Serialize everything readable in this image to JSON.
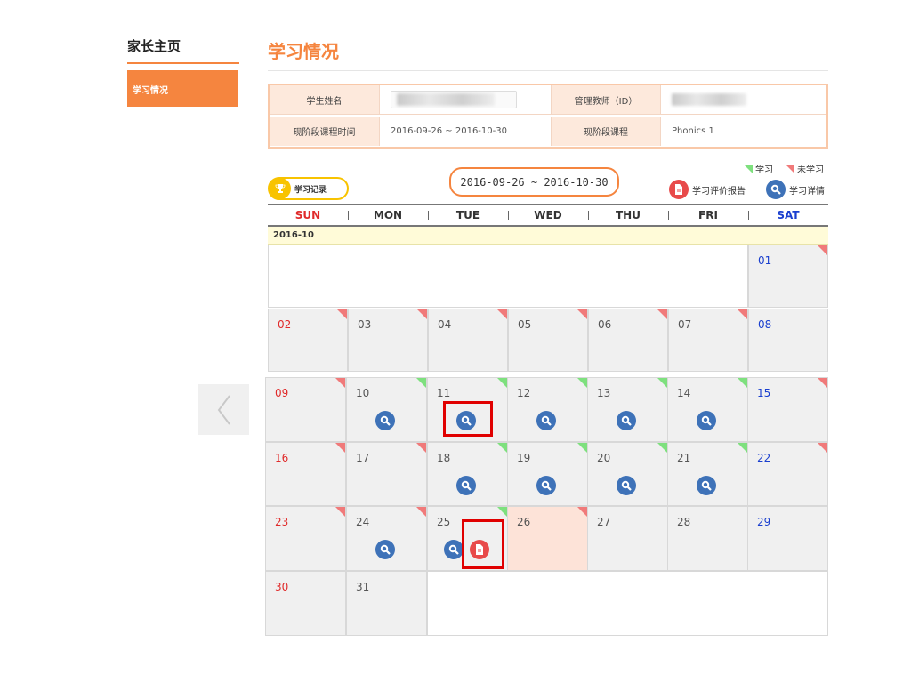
{
  "sidebar": {
    "title": "家长主页",
    "item": "学习情况"
  },
  "page": {
    "title": "学习情况"
  },
  "info": {
    "student_name_label": "学生姓名",
    "teacher_label": "管理教师（ID）",
    "period_label": "现阶段课程时间",
    "period_value": "2016-09-26 ~ 2016-10-30",
    "course_label": "现阶段课程",
    "course_value": "Phonics 1"
  },
  "calendar": {
    "record_button": "学习记录",
    "date_range": "2016-09-26 ~ 2016-10-30",
    "legend": {
      "studied": "学习",
      "not_studied": "未学习",
      "report": "学习评价报告",
      "detail": "学习详情"
    },
    "weekdays": [
      "SUN",
      "MON",
      "TUE",
      "WED",
      "THU",
      "FRI",
      "SAT"
    ],
    "month_label": "2016-10",
    "day_labels": [
      "01",
      "02",
      "03",
      "04",
      "05",
      "06",
      "07",
      "08",
      "09",
      "10",
      "11",
      "12",
      "13",
      "14",
      "15",
      "16",
      "17",
      "18",
      "19",
      "20",
      "21",
      "22",
      "23",
      "24",
      "25",
      "26",
      "27",
      "28",
      "29",
      "30",
      "31"
    ],
    "days": [
      {
        "day": 1,
        "flag": "not-studied"
      },
      {
        "day": 2,
        "flag": "not-studied"
      },
      {
        "day": 3,
        "flag": "not-studied"
      },
      {
        "day": 4,
        "flag": "not-studied"
      },
      {
        "day": 5,
        "flag": "not-studied"
      },
      {
        "day": 6,
        "flag": "not-studied"
      },
      {
        "day": 7,
        "flag": "not-studied"
      },
      {
        "day": 8,
        "flag": "none"
      },
      {
        "day": 9,
        "flag": "not-studied"
      },
      {
        "day": 10,
        "flag": "studied",
        "icons": [
          "detail"
        ]
      },
      {
        "day": 11,
        "flag": "studied",
        "icons": [
          "detail"
        ],
        "highlight": true
      },
      {
        "day": 12,
        "flag": "studied",
        "icons": [
          "detail"
        ]
      },
      {
        "day": 13,
        "flag": "studied",
        "icons": [
          "detail"
        ]
      },
      {
        "day": 14,
        "flag": "studied",
        "icons": [
          "detail"
        ]
      },
      {
        "day": 15,
        "flag": "not-studied"
      },
      {
        "day": 16,
        "flag": "not-studied"
      },
      {
        "day": 17,
        "flag": "not-studied"
      },
      {
        "day": 18,
        "flag": "studied",
        "icons": [
          "detail"
        ]
      },
      {
        "day": 19,
        "flag": "studied",
        "icons": [
          "detail"
        ]
      },
      {
        "day": 20,
        "flag": "studied",
        "icons": [
          "detail"
        ]
      },
      {
        "day": 21,
        "flag": "studied",
        "icons": [
          "detail"
        ]
      },
      {
        "day": 22,
        "flag": "not-studied"
      },
      {
        "day": 23,
        "flag": "not-studied"
      },
      {
        "day": 24,
        "flag": "not-studied",
        "icons": [
          "detail"
        ]
      },
      {
        "day": 25,
        "flag": "studied",
        "icons": [
          "detail",
          "report"
        ],
        "highlight_report": true
      },
      {
        "day": 26,
        "flag": "not-studied",
        "today": true
      },
      {
        "day": 27,
        "flag": "none"
      },
      {
        "day": 28,
        "flag": "none"
      },
      {
        "day": 29,
        "flag": "none"
      },
      {
        "day": 30,
        "flag": "none"
      },
      {
        "day": 31,
        "flag": "none"
      }
    ]
  },
  "colors": {
    "accent": "#f5853f",
    "studied": "#7ee07e",
    "not_studied": "#f07a7a",
    "detail": "#3e72b8",
    "report": "#e84a4a",
    "sunday": "#e02b2b",
    "saturday": "#1a3fcf"
  },
  "icons": {
    "detail": "magnifier-icon",
    "report": "document-icon",
    "record": "trophy-icon",
    "prev": "chevron-left-icon"
  }
}
